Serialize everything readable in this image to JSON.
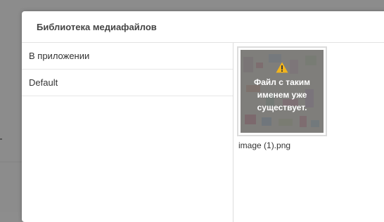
{
  "dialog": {
    "title": "Библиотека медиафайлов"
  },
  "sidebar": {
    "items": [
      {
        "label": "В приложении"
      },
      {
        "label": "Default"
      }
    ]
  },
  "media": {
    "items": [
      {
        "message": "Файл с таким именем уже существует.",
        "file_name": "image (1).png",
        "icon": "warning-icon"
      }
    ]
  },
  "colors": {
    "warning": "#f3b51b",
    "overlay": "#6e6e6e",
    "backdrop": "#8c8c8c"
  }
}
